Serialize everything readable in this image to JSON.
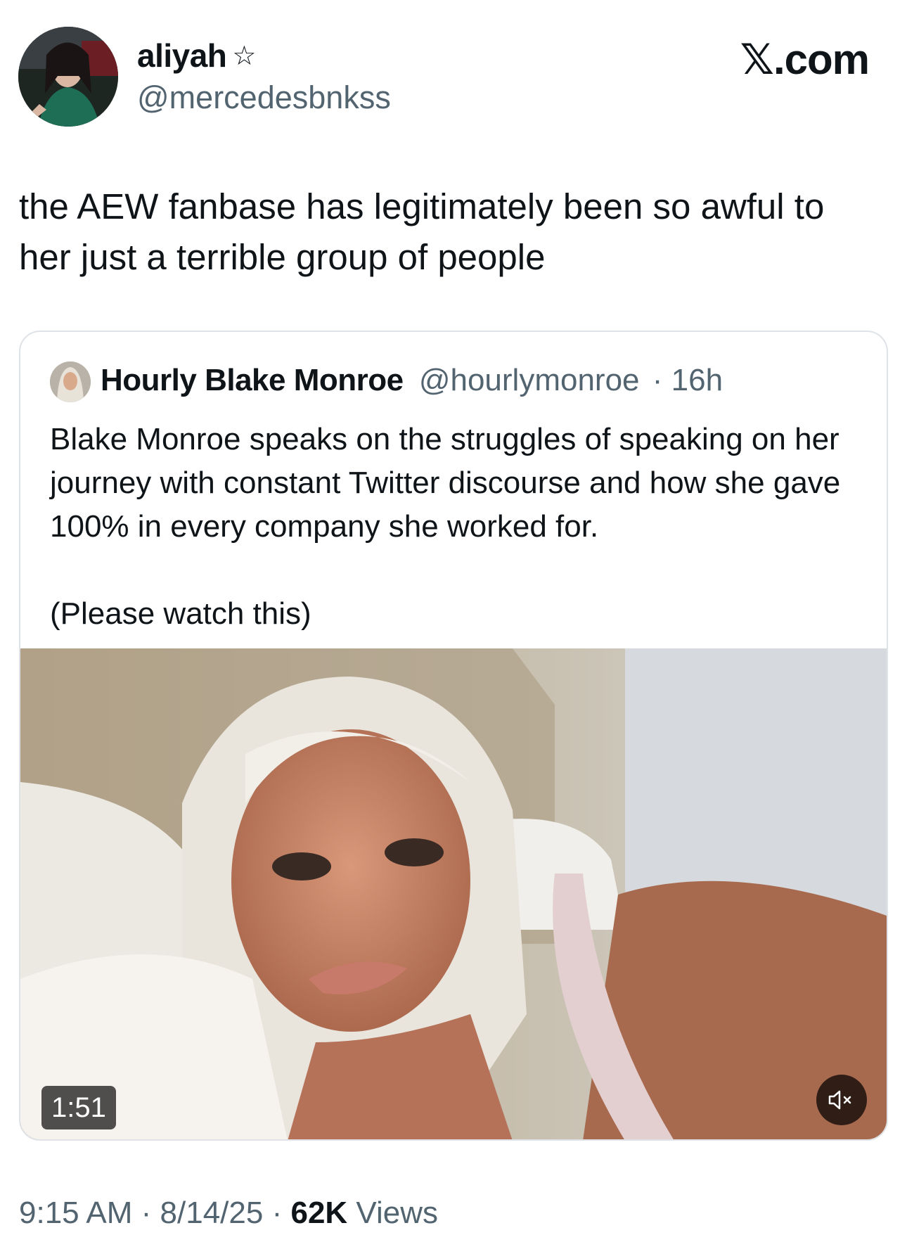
{
  "author": {
    "name": "aliyah",
    "badge_icon": "star-icon",
    "handle": "@mercedesbnkss"
  },
  "brand": "𝕏.com",
  "tweet": {
    "text": "the AEW fanbase has legitimately been so awful to her just a terrible group of people"
  },
  "quoted": {
    "name": "Hourly Blake Monroe",
    "handle": "@hourlymonroe",
    "age": "· 16h",
    "text_line1": "Blake Monroe speaks on the struggles of speaking on her journey with constant Twitter discourse and how she gave 100% in every company she worked for.",
    "text_line2": "(Please watch this)",
    "video": {
      "duration": "1:51",
      "mute_icon": "speaker-muted-icon"
    }
  },
  "footer": {
    "time": "9:15 AM",
    "date": "8/14/25",
    "views_count": "62K",
    "views_label": "Views",
    "separator": " · "
  }
}
